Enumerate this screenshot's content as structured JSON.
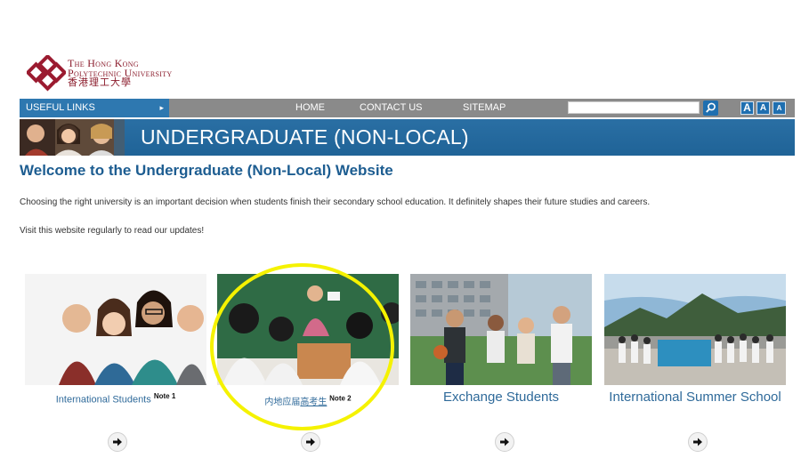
{
  "logo": {
    "line1": "The Hong Kong",
    "line2": "Polytechnic University",
    "line3": "香港理工大學"
  },
  "nav": {
    "useful_links": "USEFUL LINKS",
    "useful_arrow": "▸",
    "home": "HOME",
    "contact": "CONTACT US",
    "sitemap": "SITEMAP",
    "search_value": "",
    "font_sizes": [
      "A",
      "A",
      "A"
    ]
  },
  "banner": {
    "title": "UNDERGRADUATE (NON-LOCAL)"
  },
  "main": {
    "heading": "Welcome to the Undergraduate (Non-Local) Website",
    "intro": "Choosing the right university is an important decision when students finish their secondary school education. It definitely shapes their future studies and careers.",
    "visit": "Visit this website regularly to read our updates!"
  },
  "tiles": [
    {
      "label": "International Students",
      "note": "Note 1"
    },
    {
      "label_prefix": "内地应届",
      "label_link": "高考生",
      "note": "Note 2"
    },
    {
      "label": "Exchange Students"
    },
    {
      "label": "International Summer School"
    }
  ],
  "colors": {
    "accent_blue": "#1f6397",
    "nav_gray": "#8a8a8a",
    "highlight_yellow": "#f5f200",
    "brand_red": "#8b1c2c"
  }
}
